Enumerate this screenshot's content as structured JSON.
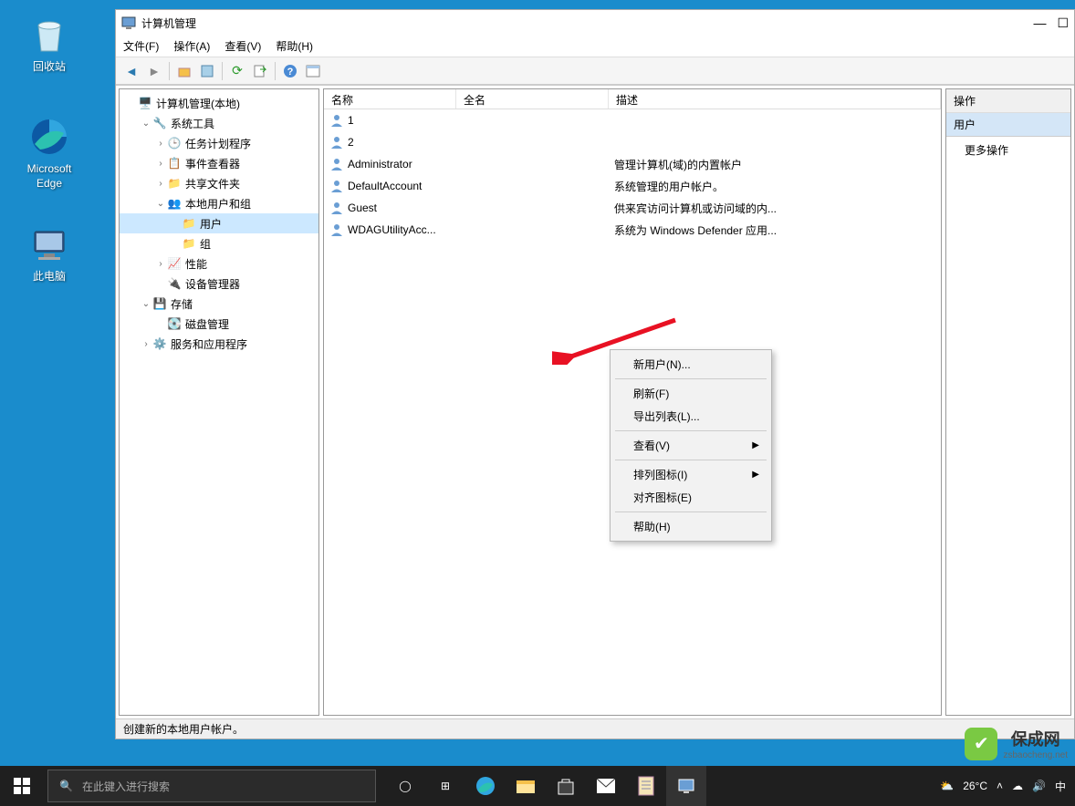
{
  "desktop_icons": {
    "recycle": "回收站",
    "edge": "Microsoft Edge",
    "thispc": "此电脑"
  },
  "window": {
    "title": "计算机管理",
    "menus": {
      "file": "文件(F)",
      "action": "操作(A)",
      "view": "查看(V)",
      "help": "帮助(H)"
    }
  },
  "tree": {
    "root": "计算机管理(本地)",
    "system_tools": "系统工具",
    "task_scheduler": "任务计划程序",
    "event_viewer": "事件查看器",
    "shared_folders": "共享文件夹",
    "local_users": "本地用户和组",
    "users": "用户",
    "groups": "组",
    "performance": "性能",
    "device_manager": "设备管理器",
    "storage": "存储",
    "disk_mgmt": "磁盘管理",
    "services_apps": "服务和应用程序"
  },
  "list": {
    "headers": {
      "name": "名称",
      "fullname": "全名",
      "desc": "描述"
    },
    "rows": [
      {
        "name": "1",
        "fullname": "",
        "desc": ""
      },
      {
        "name": "2",
        "fullname": "",
        "desc": ""
      },
      {
        "name": "Administrator",
        "fullname": "",
        "desc": "管理计算机(域)的内置帐户"
      },
      {
        "name": "DefaultAccount",
        "fullname": "",
        "desc": "系统管理的用户帐户。"
      },
      {
        "name": "Guest",
        "fullname": "",
        "desc": "供来宾访问计算机或访问域的内..."
      },
      {
        "name": "WDAGUtilityAcc...",
        "fullname": "",
        "desc": "系统为 Windows Defender 应用..."
      }
    ]
  },
  "context_menu": {
    "new_user": "新用户(N)...",
    "refresh": "刷新(F)",
    "export_list": "导出列表(L)...",
    "view": "查看(V)",
    "arrange_icons": "排列图标(I)",
    "align_icons": "对齐图标(E)",
    "help": "帮助(H)"
  },
  "actions": {
    "header": "操作",
    "section": "用户",
    "more": "更多操作"
  },
  "statusbar": "创建新的本地用户帐户。",
  "taskbar": {
    "search_placeholder": "在此键入进行搜索",
    "weather": "26°C",
    "ime": "中"
  },
  "watermark": {
    "name": "保成网",
    "url": "zsbaocheng.net"
  }
}
